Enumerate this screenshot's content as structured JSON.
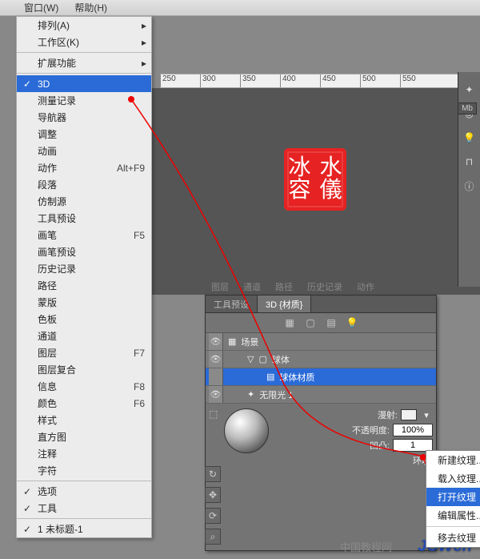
{
  "menubar": {
    "window": "窗口(W)",
    "help": "帮助(H)"
  },
  "dropdown": {
    "arrange": "排列(A)",
    "workspace": "工作区(K)",
    "extensions": "扩展功能",
    "threeD": "3D",
    "measureLog": "测量记录",
    "navigator": "导航器",
    "adjust": "调整",
    "animation": "动画",
    "actions": "动作",
    "actions_sc": "Alt+F9",
    "paragraph": "段落",
    "cloneSource": "仿制源",
    "toolPresets": "工具预设",
    "brush": "画笔",
    "brush_sc": "F5",
    "brushPresets": "画笔预设",
    "history": "历史记录",
    "paths": "路径",
    "masks": "蒙版",
    "swatches": "色板",
    "channels": "通道",
    "layers": "图层",
    "layers_sc": "F7",
    "layerComps": "图层复合",
    "info": "信息",
    "info_sc": "F8",
    "color": "颜色",
    "color_sc": "F6",
    "styles": "样式",
    "histogram": "直方图",
    "notes": "注释",
    "character": "字符",
    "options": "选项",
    "tools": "工具",
    "untitled": "1 未标题-1"
  },
  "ruler": [
    "250",
    "300",
    "350",
    "400",
    "450",
    "500",
    "550"
  ],
  "panel": {
    "toolPresetsTab": "工具预设",
    "threeDTab": "3D {材质}",
    "scene": "场景",
    "sphere": "球体",
    "sphereMaterial": "球体材质",
    "infiniteLight": "无限光 1",
    "diffuse": "漫射:",
    "opacity": "不透明度:",
    "opacity_val": "100%",
    "bump": "凹凸:",
    "bump_val": "1",
    "env": "环境:"
  },
  "backTabs": [
    "图层",
    "通道",
    "路径",
    "历史记录",
    "动作"
  ],
  "context": {
    "newTexture": "新建纹理...",
    "loadTexture": "载入纹理...",
    "openTexture": "打开纹理",
    "editProps": "编辑属性...",
    "removeTexture": "移去纹理"
  },
  "mb": "Mb",
  "watermark": "JCWcn",
  "watermark_sub": "中国教程网"
}
